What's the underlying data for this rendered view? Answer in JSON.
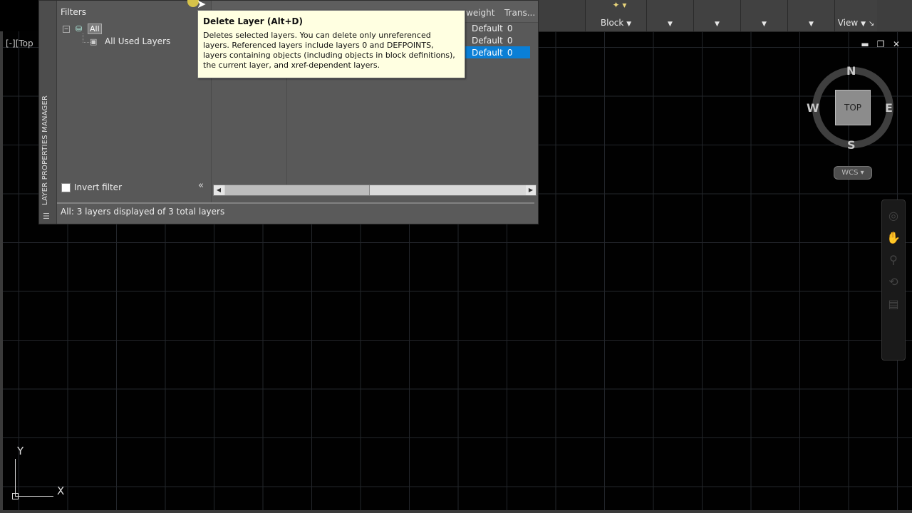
{
  "viewport": {
    "label": "[-][Top"
  },
  "ribbon": {
    "panels": [
      {
        "label": "Block",
        "has_arrow": true
      },
      {
        "label": "",
        "has_arrow": true
      },
      {
        "label": "",
        "has_arrow": true
      },
      {
        "label": "",
        "has_arrow": true
      },
      {
        "label": "",
        "has_arrow": true
      },
      {
        "label": "View",
        "has_arrow": true
      }
    ]
  },
  "palette": {
    "title": "LAYER PROPERTIES MANAGER",
    "filters_title": "Filters",
    "tree": {
      "all": "All",
      "all_used": "All Used Layers"
    },
    "invert_filter": "Invert filter",
    "columns": {
      "lineweight": "weight",
      "transparency": "Trans..."
    },
    "rows": [
      {
        "lineweight": "Default",
        "transparency": "0",
        "selected": false
      },
      {
        "lineweight": "Default",
        "transparency": "0",
        "selected": false
      },
      {
        "lineweight": "Default",
        "transparency": "0",
        "selected": true
      }
    ],
    "status": "All: 3 layers displayed of 3 total layers"
  },
  "tooltip": {
    "title": "Delete Layer (Alt+D)",
    "body": "Deletes selected layers. You can delete only unreferenced layers. Referenced layers include layers 0 and DEFPOINTS, layers containing objects (including objects in block definitions), the current layer, and xref-dependent layers."
  },
  "viewcube": {
    "face": "TOP",
    "north": "N",
    "south": "S",
    "east": "E",
    "west": "W",
    "wcs": "WCS"
  },
  "ucs": {
    "x": "X",
    "y": "Y"
  }
}
